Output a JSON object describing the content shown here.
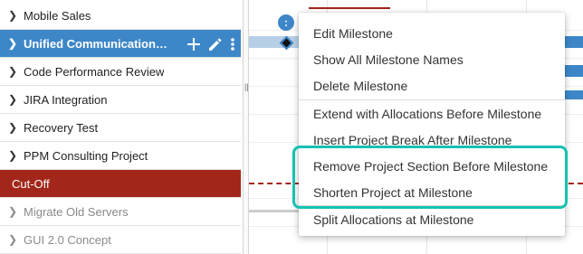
{
  "projects": [
    {
      "label": "Mobile Sales",
      "chevron": "chevron-right-icon"
    },
    {
      "label": "Unified Communications ...",
      "chevron": "chevron-right-icon"
    },
    {
      "label": "Code Performance Review",
      "chevron": "chevron-right-icon"
    },
    {
      "label": "JIRA Integration",
      "chevron": "chevron-right-icon"
    },
    {
      "label": "Recovery Test",
      "chevron": "chevron-right-icon"
    },
    {
      "label": "PPM Consulting Project",
      "chevron": "chevron-right-icon"
    },
    {
      "label": "Cut-Off"
    },
    {
      "label": "Migrate Old Servers",
      "chevron": "chevron-right-icon"
    },
    {
      "label": "GUI 2.0 Concept",
      "chevron": "chevron-right-icon"
    }
  ],
  "selected_row_actions": [
    "plus-icon",
    "pencil-icon",
    "more-vertical-icon"
  ],
  "splitter_grip": "||",
  "milestone_marker": ":",
  "context_menu": {
    "items": [
      "Edit Milestone",
      "Show All Milestone Names",
      "Delete Milestone",
      "Extend with Allocations Before Milestone",
      "Insert Project Break After Milestone",
      "Remove Project Section Before Milestone",
      "Shorten Project at Milestone",
      "Split Allocations at Milestone"
    ]
  },
  "colors": {
    "selected_row": "#3d87c8",
    "cutoff_row": "#a3261b",
    "highlight_border": "#16c1b2",
    "menu_text": "#333333"
  }
}
